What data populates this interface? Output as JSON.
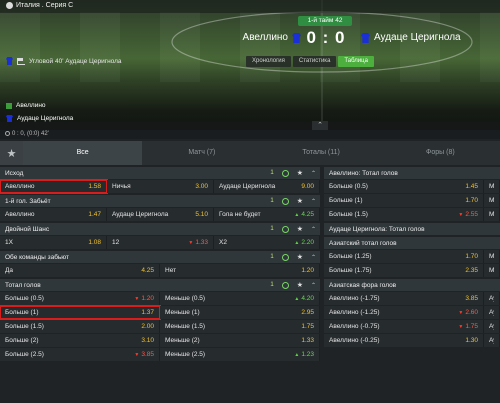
{
  "hero": {
    "league": "Италия . Серия С",
    "period": "1-й тайм 42",
    "team_home": "Авеллино",
    "team_away": "Аудаце Церигнола",
    "score": "0 : 0",
    "view_tabs": [
      "Хронология",
      "Статистика",
      "Таблица"
    ],
    "active_view_tab": "Таблица",
    "event": "Угловой 40' Аудаце Церигнола",
    "legend_home": "Авеллино",
    "legend_away": "Аудаце Церигнола",
    "kit_color": "#1a2fd6"
  },
  "status": {
    "text": "0 : 0, (0:0) 42'"
  },
  "tabs": {
    "items": [
      "Все",
      "Матч (7)",
      "Тоталы (11)",
      "Форы (8)"
    ],
    "active": "Все"
  },
  "left_markets": [
    {
      "title": "Исход",
      "rows": [
        [
          {
            "label": "Авеллино",
            "odd": "1.58",
            "trend": "none",
            "highlight": true
          },
          {
            "label": "Ничья",
            "odd": "3.00",
            "trend": "none"
          },
          {
            "label": "Аудаце Церигнола",
            "odd": "9.00",
            "trend": "none"
          }
        ]
      ]
    },
    {
      "title": "1-й гол. Забьёт",
      "rows": [
        [
          {
            "label": "Авеллино",
            "odd": "1.47",
            "trend": "none"
          },
          {
            "label": "Аудаце Церигнола",
            "odd": "5.10",
            "trend": "none"
          },
          {
            "label": "Гола не будет",
            "odd": "4.25",
            "trend": "up"
          }
        ]
      ]
    },
    {
      "title": "Двойной Шанс",
      "rows": [
        [
          {
            "label": "1Х",
            "odd": "1.08",
            "trend": "none"
          },
          {
            "label": "12",
            "odd": "1.33",
            "trend": "down"
          },
          {
            "label": "Х2",
            "odd": "2.20",
            "trend": "up"
          }
        ]
      ]
    },
    {
      "title": "Обе команды забьют",
      "rows": [
        [
          {
            "label": "Да",
            "odd": "4.25",
            "trend": "none"
          },
          {
            "label": "Нет",
            "odd": "1.20",
            "trend": "none"
          }
        ]
      ]
    },
    {
      "title": "Тотал голов",
      "rows": [
        [
          {
            "label": "Больше (0.5)",
            "odd": "1.20",
            "trend": "down"
          },
          {
            "label": "Меньше (0.5)",
            "odd": "4.20",
            "trend": "up"
          }
        ],
        [
          {
            "label": "Больше (1)",
            "odd": "1.37",
            "trend": "none",
            "highlight": true
          },
          {
            "label": "Меньше (1)",
            "odd": "2.95",
            "trend": "none"
          }
        ],
        [
          {
            "label": "Больше (1.5)",
            "odd": "2.00",
            "trend": "none"
          },
          {
            "label": "Меньше (1.5)",
            "odd": "1.75",
            "trend": "none"
          }
        ],
        [
          {
            "label": "Больше (2)",
            "odd": "3.10",
            "trend": "none"
          },
          {
            "label": "Меньше (2)",
            "odd": "1.33",
            "trend": "none"
          }
        ],
        [
          {
            "label": "Больше (2.5)",
            "odd": "3.85",
            "trend": "down"
          },
          {
            "label": "Меньше (2.5)",
            "odd": "1.23",
            "trend": "up"
          }
        ]
      ]
    }
  ],
  "right_markets": [
    {
      "title": "Авеллино: Тотал голов",
      "rows": [
        [
          {
            "label": "Больше (0.5)",
            "odd": "1.45",
            "trend": "none"
          },
          {
            "label": "Мен",
            "odd": "",
            "trend": "none"
          }
        ],
        [
          {
            "label": "Больше (1)",
            "odd": "1.70",
            "trend": "none"
          },
          {
            "label": "Мен",
            "odd": "",
            "trend": "none"
          }
        ],
        [
          {
            "label": "Больше (1.5)",
            "odd": "2.55",
            "trend": "down"
          },
          {
            "label": "Мен",
            "odd": "",
            "trend": "none"
          }
        ]
      ]
    },
    {
      "title": "Аудаце Церигнола: Тотал голов",
      "rows": []
    },
    {
      "title": "Азиатский тотал голов",
      "rows": [
        [
          {
            "label": "Больше (1.25)",
            "odd": "1.70",
            "trend": "none"
          },
          {
            "label": "Мен",
            "odd": "",
            "trend": "none"
          }
        ],
        [
          {
            "label": "Больше (1.75)",
            "odd": "2.35",
            "trend": "none"
          },
          {
            "label": "Мен",
            "odd": "",
            "trend": "none"
          }
        ]
      ]
    },
    {
      "title": "Азиатская фора голов",
      "rows": [
        [
          {
            "label": "Авеллино (-1.75)",
            "odd": "3.85",
            "trend": "none"
          },
          {
            "label": "Ауд",
            "odd": "",
            "trend": "none"
          }
        ],
        [
          {
            "label": "Авеллино (-1.25)",
            "odd": "2.60",
            "trend": "down"
          },
          {
            "label": "Ауд",
            "odd": "",
            "trend": "none"
          }
        ],
        [
          {
            "label": "Авеллино (-0.75)",
            "odd": "1.75",
            "trend": "down"
          },
          {
            "label": "Ауд",
            "odd": "",
            "trend": "none"
          }
        ],
        [
          {
            "label": "Авеллино (-0.25)",
            "odd": "1.30",
            "trend": "none"
          },
          {
            "label": "Ауд",
            "odd": "",
            "trend": "none"
          }
        ]
      ]
    }
  ],
  "header_tools": {
    "chain": "1",
    "star": "★",
    "chevron": "⌃"
  }
}
